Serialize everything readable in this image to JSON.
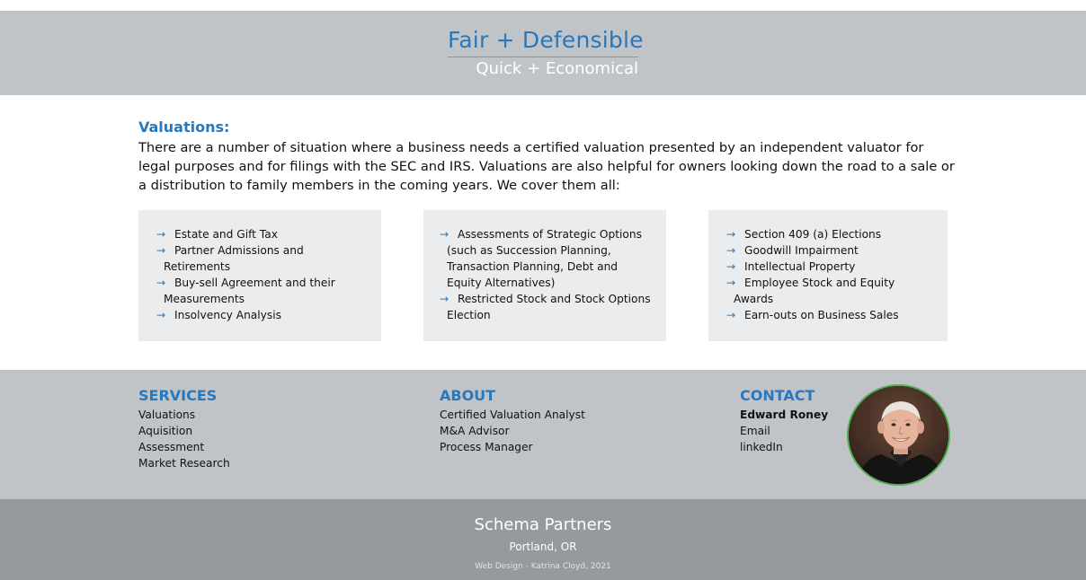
{
  "hero": {
    "title": "Fair + Defensible",
    "subtitle": "Quick + Economical"
  },
  "intro": {
    "heading": "Valuations:",
    "text": "There are a number of situation where a business needs a certified valuation presented by an independent valuator for legal purposes and for filings with the SEC and IRS. Valuations are also helpful for owners looking down the road to a sale or a distribution to family members in the coming years. We cover them all:"
  },
  "arrow_glyph": "→",
  "cards": [
    {
      "items": [
        "Estate and Gift Tax",
        "Partner Admissions and Retirements",
        "Buy-sell Agreement and their Measurements",
        "Insolvency Analysis"
      ]
    },
    {
      "items": [
        "Assessments of Strategic Options (such as Succession Planning, Transaction Planning, Debt and Equity Alternatives)",
        "Restricted Stock and Stock Options Election"
      ]
    },
    {
      "items": [
        "Section 409 (a) Elections",
        "Goodwill Impairment",
        "Intellectual Property",
        "Employee Stock and Equity Awards",
        "Earn-outs on Business Sales"
      ]
    }
  ],
  "footer": {
    "services": {
      "heading": "SERVICES",
      "items": [
        "Valuations",
        "Aquisition",
        "Assessment",
        "Market Research"
      ]
    },
    "about": {
      "heading": "ABOUT",
      "items": [
        "Certified Valuation Analyst",
        "M&A Advisor",
        "Process Manager"
      ]
    },
    "contact": {
      "heading": "CONTACT",
      "name": "Edward Roney",
      "email": "Email",
      "linkedin": "linkedIn"
    }
  },
  "bottom": {
    "company": "Schema Partners",
    "location": "Portland, OR",
    "credit": "Web Design - Katrina Cloyd, 2021"
  },
  "colors": {
    "accent_blue": "#2878be",
    "band_gray": "#c1c4c7",
    "bottom_gray": "#959a9c",
    "card_bg": "#ebecee",
    "avatar_ring": "#4caf50"
  }
}
